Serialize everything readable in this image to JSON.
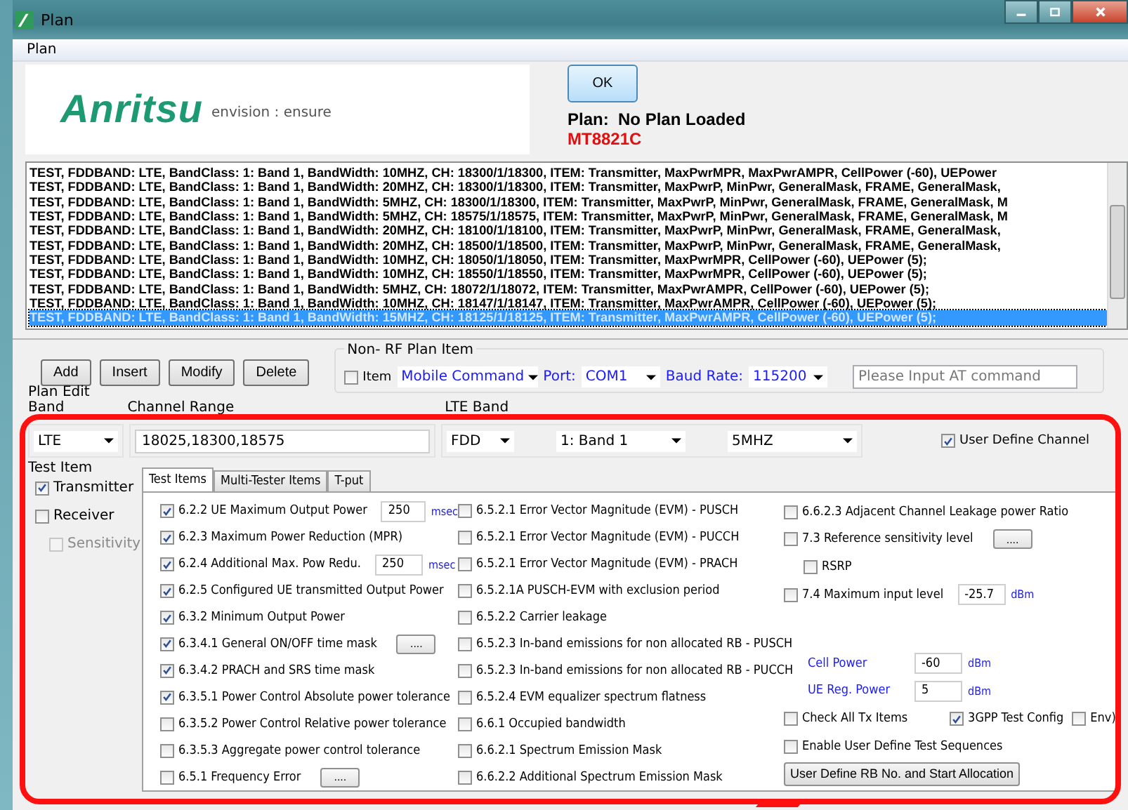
{
  "window": {
    "title": "Plan"
  },
  "menu": [
    {
      "label": "Plan"
    }
  ],
  "header": {
    "logo": "Anritsu",
    "tagline": "envision : ensure",
    "ok_button": "OK",
    "plan_label": "Plan:  No Plan Loaded",
    "model": "MT8821C"
  },
  "plan_list": {
    "rows": [
      {
        "text": "TEST, FDDBAND: LTE, BandClass: 1: Band 1, BandWidth: 10MHZ, CH: 18300/1/18300, ITEM: Transmitter, MaxPwrMPR, MaxPwrAMPR, CellPower (-60), UEPower",
        "selected": false
      },
      {
        "text": "TEST, FDDBAND: LTE, BandClass: 1: Band 1, BandWidth: 20MHZ, CH: 18300/1/18300, ITEM: Transmitter, MaxPwrP, MinPwr, GeneralMask, FRAME, GeneralMask,",
        "selected": false
      },
      {
        "text": "TEST, FDDBAND: LTE, BandClass: 1: Band 1, BandWidth: 5MHZ, CH: 18300/1/18300, ITEM: Transmitter, MaxPwrP, MinPwr, GeneralMask, FRAME, GeneralMask, M",
        "selected": false
      },
      {
        "text": "TEST, FDDBAND: LTE, BandClass: 1: Band 1, BandWidth: 5MHZ, CH: 18575/1/18575, ITEM: Transmitter, MaxPwrP, MinPwr, GeneralMask, FRAME, GeneralMask, M",
        "selected": false
      },
      {
        "text": "TEST, FDDBAND: LTE, BandClass: 1: Band 1, BandWidth: 20MHZ, CH: 18100/1/18100, ITEM: Transmitter, MaxPwrP, MinPwr, GeneralMask, FRAME, GeneralMask,",
        "selected": false
      },
      {
        "text": "TEST, FDDBAND: LTE, BandClass: 1: Band 1, BandWidth: 20MHZ, CH: 18500/1/18500, ITEM: Transmitter, MaxPwrP, MinPwr, GeneralMask, FRAME, GeneralMask,",
        "selected": false
      },
      {
        "text": "TEST, FDDBAND: LTE, BandClass: 1: Band 1, BandWidth: 10MHZ, CH: 18050/1/18050, ITEM: Transmitter, MaxPwrMPR, CellPower (-60), UEPower (5);",
        "selected": false
      },
      {
        "text": "TEST, FDDBAND: LTE, BandClass: 1: Band 1, BandWidth: 10MHZ, CH: 18550/1/18550, ITEM: Transmitter, MaxPwrMPR, CellPower (-60), UEPower (5);",
        "selected": false
      },
      {
        "text": "TEST, FDDBAND: LTE, BandClass: 1: Band 1, BandWidth: 5MHZ, CH: 18072/1/18072, ITEM: Transmitter, MaxPwrAMPR, CellPower (-60), UEPower (5);",
        "selected": false
      },
      {
        "text": "TEST, FDDBAND: LTE, BandClass: 1: Band 1, BandWidth: 10MHZ, CH: 18147/1/18147, ITEM: Transmitter, MaxPwrAMPR, CellPower (-60), UEPower (5);",
        "selected": false
      },
      {
        "text": "TEST, FDDBAND: LTE, BandClass: 1: Band 1, BandWidth: 15MHZ, CH: 18125/1/18125, ITEM: Transmitter, MaxPwrAMPR, CellPower (-60), UEPower (5);",
        "selected": true
      }
    ]
  },
  "actions": [
    {
      "label": "Add"
    },
    {
      "label": "Insert"
    },
    {
      "label": "Modify"
    },
    {
      "label": "Delete"
    }
  ],
  "non_rf": {
    "title": "Non- RF Plan Item",
    "item": {
      "label": "Item",
      "checked": false
    },
    "command": "Mobile Command",
    "port_label": "Port:",
    "port": "COM1",
    "baud_label": "Baud Rate:",
    "baud": "115200",
    "at_command": {
      "placeholder": "Please Input AT command"
    }
  },
  "plan_edit": {
    "title": "Plan Edit",
    "band_label": "Band",
    "band": "LTE",
    "channel_label": "Channel Range",
    "channel": "18025,18300,18575",
    "lte_band_label": "LTE Band",
    "duplex": "FDD",
    "band_number": "1: Band 1",
    "bandwidth": "5MHZ",
    "user_define_channel": {
      "label": "User Define Channel",
      "checked": true
    }
  },
  "test_item": {
    "title": "Test Item",
    "options": [
      {
        "label": "Transmitter",
        "checked": true,
        "disabled": false
      },
      {
        "label": "Receiver",
        "checked": false,
        "disabled": false,
        "children": [
          {
            "label": "Sensitivity",
            "checked": false,
            "disabled": true
          }
        ]
      }
    ]
  },
  "tabs": [
    {
      "label": "Test Items",
      "selected": true
    },
    {
      "label": "Multi-Tester Items",
      "selected": false
    },
    {
      "label": "T-put",
      "selected": false
    }
  ],
  "column_1": [
    {
      "kind": "check",
      "label": "6.2.2 UE Maximum Output Power",
      "checked": true,
      "field": "250",
      "unit": "msec"
    },
    {
      "kind": "check",
      "label": "6.2.3 Maximum Power Reduction (MPR)",
      "checked": true
    },
    {
      "kind": "check",
      "label": "6.2.4 Additional Max. Pow Redu.",
      "checked": true,
      "field": "250",
      "unit": "msec"
    },
    {
      "kind": "check",
      "label": "6.2.5 Configured UE transmitted Output Power",
      "checked": true
    },
    {
      "kind": "check",
      "label": "6.3.2 Minimum Output Power",
      "checked": true
    },
    {
      "kind": "check",
      "label": "6.3.4.1 General ON/OFF time mask",
      "checked": true,
      "button": "...."
    },
    {
      "kind": "check",
      "label": "6.3.4.2 PRACH and SRS time mask",
      "checked": true
    },
    {
      "kind": "check",
      "label": "6.3.5.1 Power Control Absolute power tolerance",
      "checked": true
    },
    {
      "kind": "check",
      "label": "6.3.5.2 Power Control Relative power tolerance",
      "checked": false
    },
    {
      "kind": "check",
      "label": "6.3.5.3 Aggregate power control tolerance",
      "checked": false
    },
    {
      "kind": "check",
      "label": "6.5.1 Frequency Error",
      "checked": false,
      "button": "...."
    }
  ],
  "column_2": [
    {
      "kind": "check",
      "label": "6.5.2.1 Error Vector Magnitude (EVM) - PUSCH",
      "checked": false
    },
    {
      "kind": "check",
      "label": "6.5.2.1 Error Vector Magnitude (EVM) - PUCCH",
      "checked": false
    },
    {
      "kind": "check",
      "label": "6.5.2.1 Error Vector Magnitude (EVM) - PRACH",
      "checked": false
    },
    {
      "kind": "check",
      "label": "6.5.2.1A PUSCH-EVM with exclusion period",
      "checked": false
    },
    {
      "kind": "check",
      "label": "6.5.2.2 Carrier leakage",
      "checked": false
    },
    {
      "kind": "check",
      "label": "6.5.2.3 In-band emissions for non allocated RB - PUSCH",
      "checked": false
    },
    {
      "kind": "check",
      "label": "6.5.2.3 In-band emissions for non allocated RB - PUCCH",
      "checked": false
    },
    {
      "kind": "check",
      "label": "6.5.2.4 EVM equalizer spectrum flatness",
      "checked": false
    },
    {
      "kind": "check",
      "label": "6.6.1 Occupied bandwidth",
      "checked": false
    },
    {
      "kind": "check",
      "label": "6.6.2.1 Spectrum Emission Mask",
      "checked": false
    },
    {
      "kind": "check",
      "label": "6.6.2.2 Additional Spectrum Emission Mask",
      "checked": false
    }
  ],
  "column_3_top": [
    {
      "kind": "check",
      "label": "6.6.2.3 Adjacent Channel Leakage power Ratio",
      "checked": false
    },
    {
      "kind": "check",
      "label": "7.3 Reference sensitivity level",
      "checked": false,
      "button": "....",
      "children": [
        {
          "kind": "check",
          "label": "RSRP",
          "checked": false
        }
      ]
    },
    {
      "kind": "check",
      "label": "7.4 Maximum input level",
      "checked": false,
      "field": "-25.7",
      "unit": "dBm"
    }
  ],
  "column_3_bottom": [
    {
      "kind": "value",
      "label": "Cell Power",
      "field": "-60",
      "unit": "dBm"
    },
    {
      "kind": "value",
      "label": "UE Reg. Power",
      "field": "5",
      "unit": "dBm"
    },
    {
      "kind": "group",
      "items": [
        {
          "label": "Check All Tx Items",
          "checked": false
        },
        {
          "label": "3GPP Test Config",
          "checked": true
        },
        {
          "label": "Env)",
          "checked": false
        }
      ]
    },
    {
      "kind": "check",
      "label": "Enable User Define Test Sequences",
      "checked": false
    },
    {
      "kind": "button",
      "label": "User Define RB No. and Start Allocation"
    }
  ]
}
